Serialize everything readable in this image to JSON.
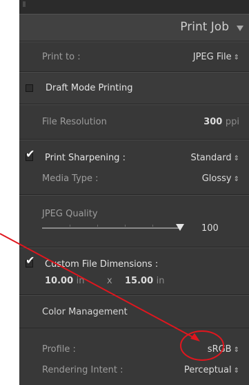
{
  "panel": {
    "title": "Print Job"
  },
  "print_to": {
    "label": "Print to :",
    "value": "JPEG File"
  },
  "draft_mode": {
    "label": "Draft Mode Printing",
    "checked": false
  },
  "file_resolution": {
    "label": "File Resolution",
    "value": "300",
    "unit": "ppi"
  },
  "print_sharpening": {
    "label": "Print Sharpening :",
    "checked": true,
    "value": "Standard"
  },
  "media_type": {
    "label": "Media Type :",
    "value": "Glossy"
  },
  "jpeg_quality": {
    "label": "JPEG Quality",
    "value": "100",
    "level": 1.0
  },
  "custom_dimensions": {
    "label": "Custom File Dimensions :",
    "checked": true,
    "width": "10.00",
    "width_unit": "in",
    "separator": "x",
    "height": "15.00",
    "height_unit": "in"
  },
  "color_management": {
    "heading": "Color Management",
    "profile_label": "Profile :",
    "profile_value": "sRGB",
    "intent_label": "Rendering Intent :",
    "intent_value": "Perceptual"
  },
  "icons": {
    "stepper": "⇕"
  },
  "colors": {
    "annotation": "#e0161e",
    "panel_bg": "#383838",
    "header_bg": "#414141"
  }
}
